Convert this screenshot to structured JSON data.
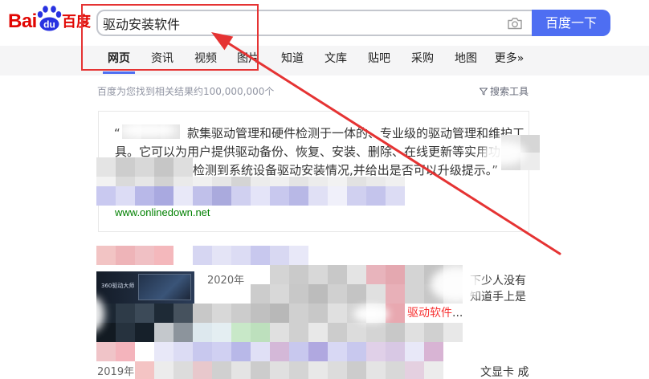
{
  "logo": {
    "bai": "Bai",
    "du": "du",
    "cn": "百度"
  },
  "search": {
    "query": "驱动安装软件",
    "button_label": "百度一下"
  },
  "tabs": {
    "active_index": 0,
    "items": [
      {
        "label": "网页"
      },
      {
        "label": "资讯"
      },
      {
        "label": "视频"
      },
      {
        "label": "图片"
      },
      {
        "label": "知道"
      },
      {
        "label": "文库"
      },
      {
        "label": "贴吧"
      },
      {
        "label": "采购"
      },
      {
        "label": "地图"
      },
      {
        "label": "更多»"
      }
    ]
  },
  "results_meta": {
    "count_text": "百度为您找到相关结果约100,000,000个",
    "tools_label": "搜索工具"
  },
  "results": [
    {
      "open_quote": "“",
      "snippet_lines": [
        "款集驱动管理和硬件检测于一体的、专业级的驱动管理和维护工",
        "具。它可以为用户提供驱动备份、恢复、安装、删除、在线更新等实用功能",
        "检测到系统设备驱动安装情况,并给出是否可以升级提示。”"
      ],
      "url": "www.onlinedown.net"
    },
    {
      "thumbnail_caption": "360驱动大师",
      "date": "2020年",
      "snippet_fragments": [
        "下少人没有",
        "知道手上是"
      ],
      "highlight": "驱动软件",
      "ellipsis": "..."
    },
    {
      "date": "2019年",
      "snippet_fragment": "文显卡 成"
    }
  ],
  "icons": {
    "logo": "baidu-paw-icon",
    "camera": "camera-icon",
    "filter": "funnel-icon"
  },
  "colors": {
    "brand_red": "#e10602",
    "brand_blue": "#2932e1",
    "button_blue": "#4e6ef2",
    "annotation_red": "#e53333",
    "url_green": "#008000",
    "highlight_red": "#f73131"
  }
}
